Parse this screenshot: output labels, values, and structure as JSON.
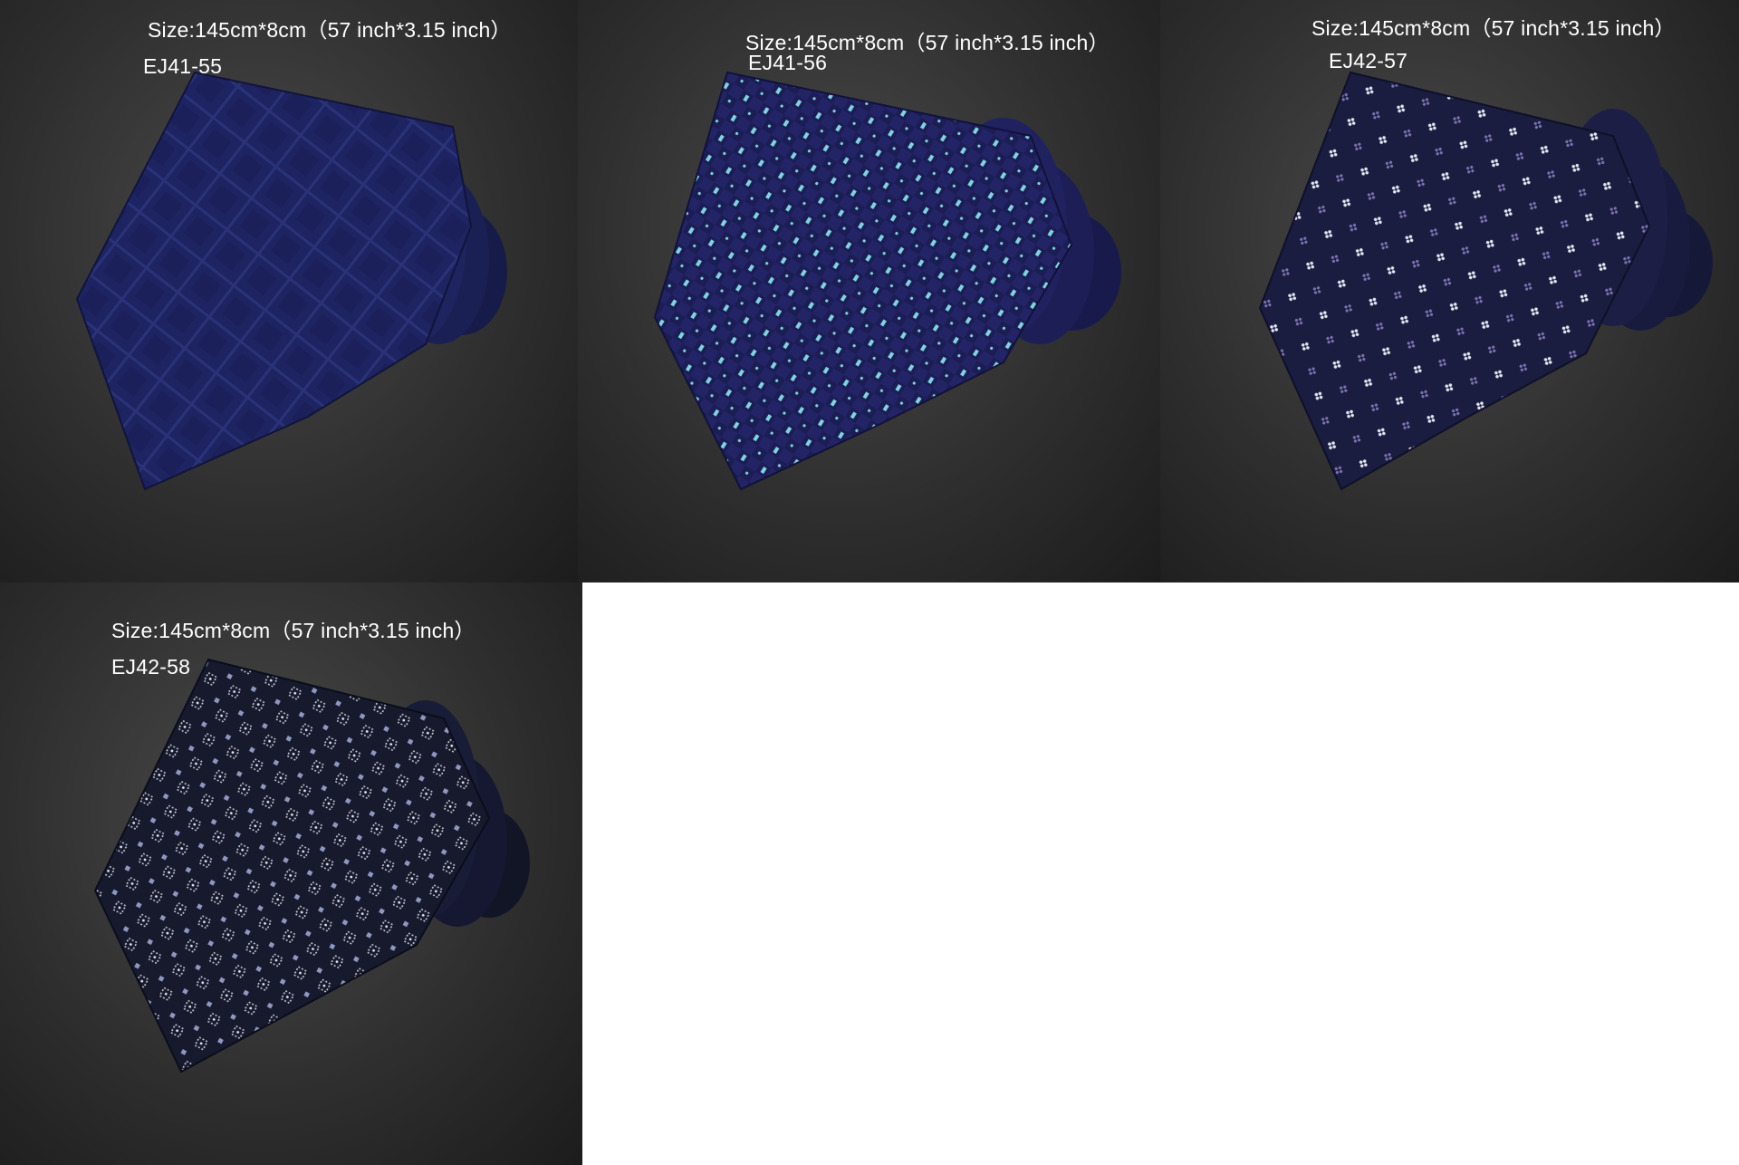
{
  "panels": [
    {
      "size_text": "Size:145cm*8cm（57 inch*3.15 inch）",
      "code": "EJ41-55",
      "pattern": "plaid",
      "base_color": "#1e2461",
      "accent_color": "#2a3278"
    },
    {
      "size_text": "Size:145cm*8cm（57 inch*3.15 inch）",
      "code": "EJ41-56",
      "pattern": "check-dots",
      "base_color": "#1c1d55",
      "accent_color": "#7fd3e0"
    },
    {
      "size_text": "Size:145cm*8cm（57 inch*3.15 inch）",
      "code": "EJ42-57",
      "pattern": "floral-dots",
      "base_color": "#1a1c40",
      "accent_color": "#e4e6f2"
    },
    {
      "size_text": "Size:145cm*8cm（57 inch*3.15 inch）",
      "code": "EJ42-58",
      "pattern": "diamond-dots",
      "base_color": "#161a2c",
      "accent_color": "#c8cbd8"
    }
  ]
}
